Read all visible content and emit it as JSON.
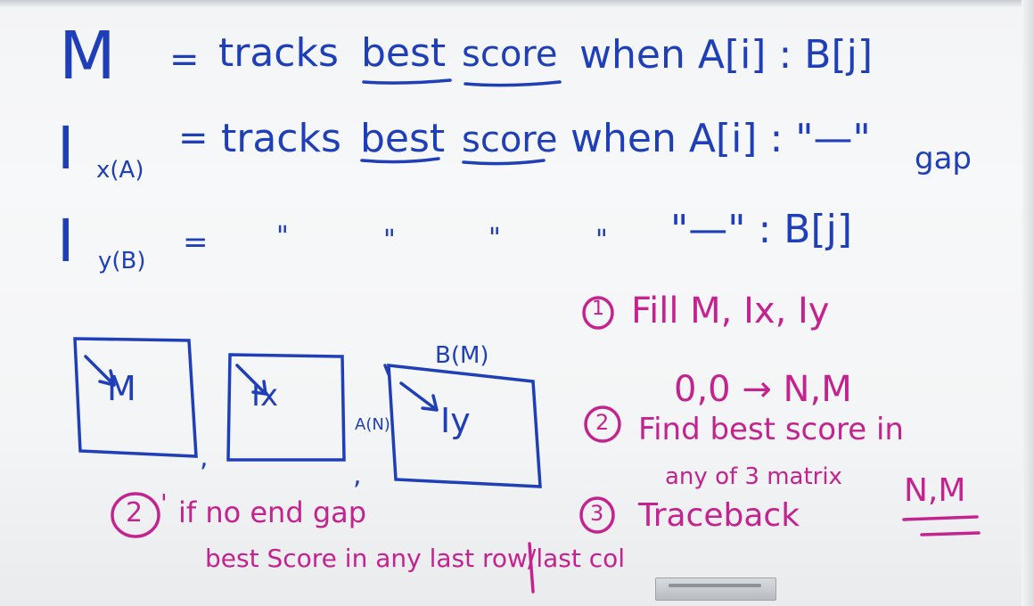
{
  "board": {
    "line1": {
      "lhs": "M",
      "eq": "=",
      "text_a": "tracks",
      "text_b": "best",
      "text_c": "score",
      "text_d": "when A[i] : B[j]"
    },
    "line2": {
      "lhs": "I",
      "sub": "x(A)",
      "eq": "=",
      "text_a": "tracks",
      "text_b": "best",
      "text_c": "score",
      "text_d": "when A[i] : \"—\"",
      "suffix": "gap"
    },
    "line3": {
      "lhs": "I",
      "sub": "y(B)",
      "eq": "=",
      "ditto1": "\"",
      "ditto2": "\"",
      "ditto3": "\"",
      "ditto4": "\"",
      "text_d": "\"—\" : B[j]"
    },
    "matrices": {
      "m1_label": "M",
      "m2_label": "Ix",
      "m3_label": "Iy",
      "m3_top": "B(M)",
      "m3_left": "A(N)",
      "comma": ","
    },
    "steps": {
      "step1_num": "1",
      "step1_text": "Fill  M, Ix, Iy",
      "step1_sub": "0,0 → N,M",
      "step2_num": "2",
      "step2_text": "Find best score in",
      "step2_sub": "any of 3 matrix",
      "step2_nm": "N,M",
      "step3_num": "3",
      "step3_text": "Traceback"
    },
    "note": {
      "num": "2",
      "prime": "'",
      "line1": "if no end gap",
      "line2": "best Score in any last row/last col"
    },
    "colors": {
      "blue": "#1f3fb8",
      "pink": "#c4238f"
    }
  }
}
